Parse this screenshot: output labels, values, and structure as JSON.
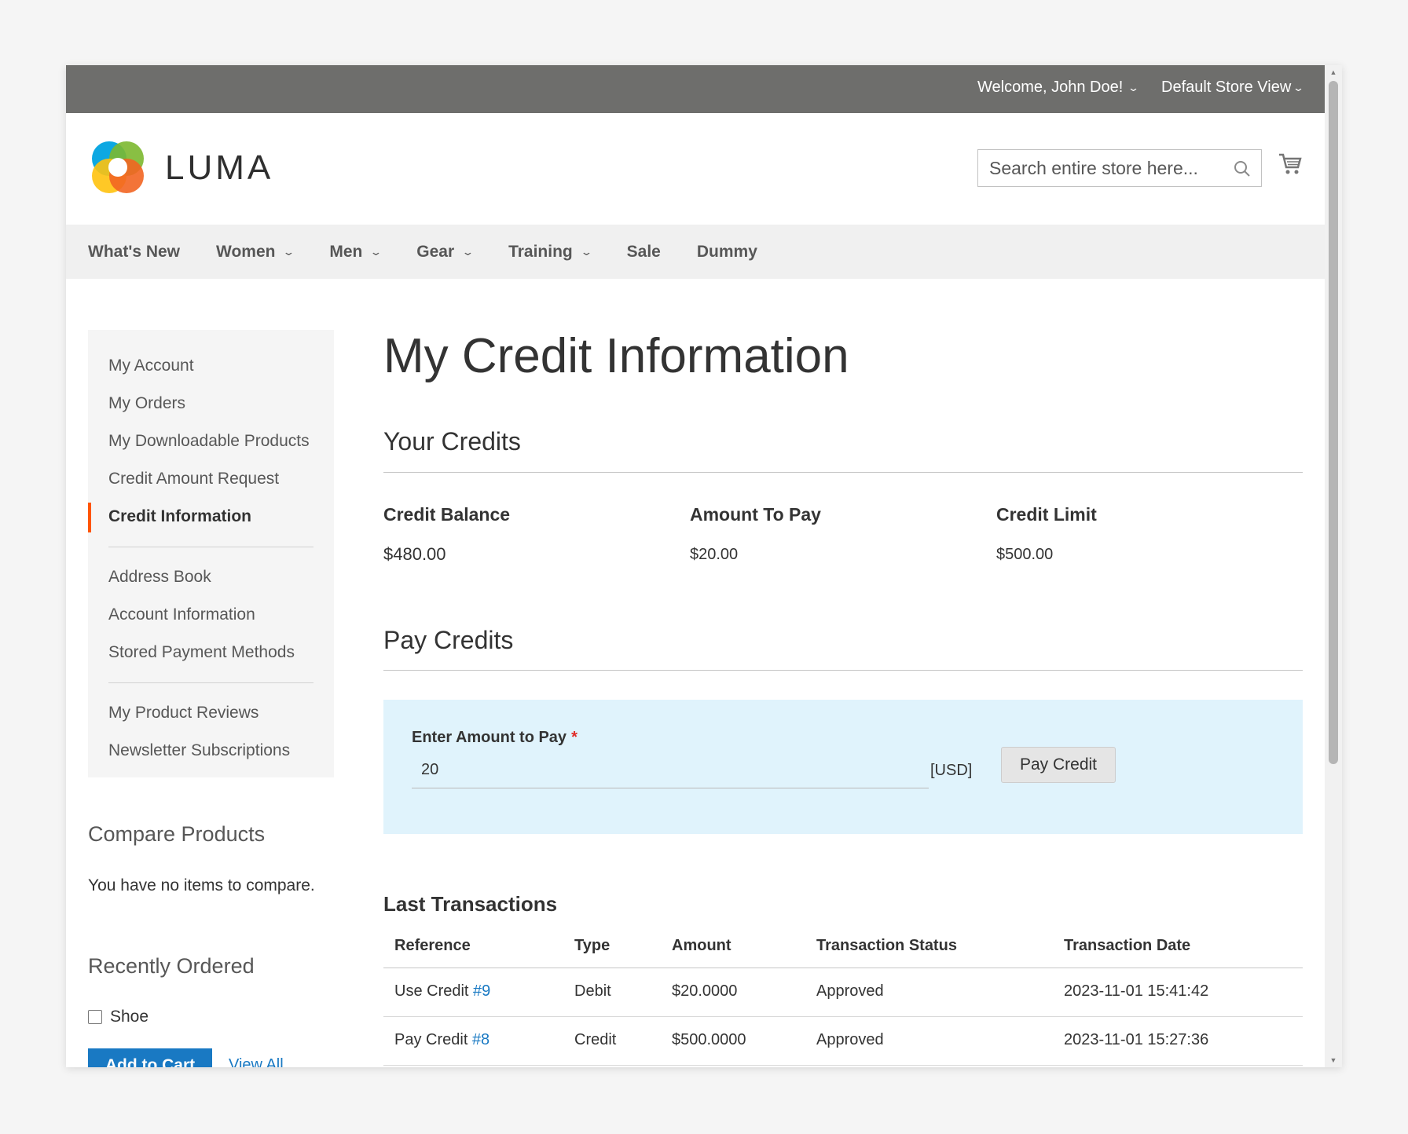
{
  "topbar": {
    "welcome": "Welcome, John Doe!",
    "store_view": "Default Store View"
  },
  "header": {
    "logo_text": "LUMA",
    "search_placeholder": "Search entire store here..."
  },
  "nav": {
    "items": [
      {
        "label": "What's New",
        "has_dropdown": false
      },
      {
        "label": "Women",
        "has_dropdown": true
      },
      {
        "label": "Men",
        "has_dropdown": true
      },
      {
        "label": "Gear",
        "has_dropdown": true
      },
      {
        "label": "Training",
        "has_dropdown": true
      },
      {
        "label": "Sale",
        "has_dropdown": false
      },
      {
        "label": "Dummy",
        "has_dropdown": false
      }
    ]
  },
  "sidebar": {
    "groups": [
      [
        "My Account",
        "My Orders",
        "My Downloadable Products",
        "Credit Amount Request",
        "Credit Information"
      ],
      [
        "Address Book",
        "Account Information",
        "Stored Payment Methods"
      ],
      [
        "My Product Reviews",
        "Newsletter Subscriptions"
      ]
    ],
    "active": "Credit Information"
  },
  "compare": {
    "title": "Compare Products",
    "text": "You have no items to compare."
  },
  "recent": {
    "title": "Recently Ordered",
    "item": "Shoe",
    "add_to_cart": "Add to Cart",
    "view_all": "View All"
  },
  "page": {
    "title": "My Credit Information",
    "your_credits_title": "Your Credits",
    "credits": [
      {
        "label": "Credit Balance",
        "value": "$480.00"
      },
      {
        "label": "Amount To Pay",
        "value": "$20.00"
      },
      {
        "label": "Credit Limit",
        "value": "$500.00"
      }
    ],
    "pay_credits_title": "Pay Credits",
    "pay": {
      "label": "Enter Amount to Pay",
      "required_mark": "*",
      "value": "20",
      "currency": "[USD]",
      "button": "Pay Credit"
    },
    "transactions": {
      "title": "Last Transactions",
      "headers": [
        "Reference",
        "Type",
        "Amount",
        "Transaction Status",
        "Transaction Date"
      ],
      "rows": [
        {
          "ref_text": "Use Credit",
          "ref_link": "#9",
          "type": "Debit",
          "amount": "$20.0000",
          "status": "Approved",
          "date": "2023-11-01 15:41:42"
        },
        {
          "ref_text": "Pay Credit",
          "ref_link": "#8",
          "type": "Credit",
          "amount": "$500.0000",
          "status": "Approved",
          "date": "2023-11-01 15:27:36"
        }
      ]
    }
  },
  "colors": {
    "topbar": "#6e6e6c",
    "link": "#1979c3",
    "active_marker": "#ff5501",
    "paybox": "#e0f3fc"
  }
}
